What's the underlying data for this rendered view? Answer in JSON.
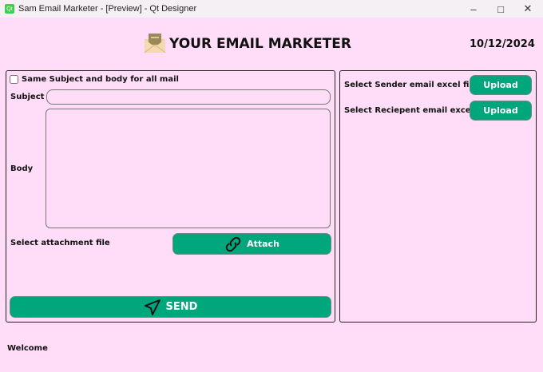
{
  "window": {
    "title": "Sam Email Marketer - [Preview] - Qt Designer",
    "app_icon_text": "Qt"
  },
  "header": {
    "title": "YOUR EMAIL MARKETER",
    "date": "10/12/2024"
  },
  "compose": {
    "same_checkbox_label": "Same Subject and body for all mail",
    "same_checked": false,
    "subject_label": "Subject",
    "subject_value": "",
    "body_label": "Body",
    "body_value": "",
    "attachment_label": "Select attachment file",
    "attach_button": "Attach",
    "send_button": "SEND"
  },
  "files": {
    "sender_label": "Select Sender email excel file",
    "sender_button": "Upload",
    "recipient_label": "Select Reciepent email excel file",
    "recipient_button": "Upload"
  },
  "status": {
    "text": "Welcome"
  },
  "colors": {
    "background": "#ffdcf8",
    "accent": "#00a67c"
  }
}
